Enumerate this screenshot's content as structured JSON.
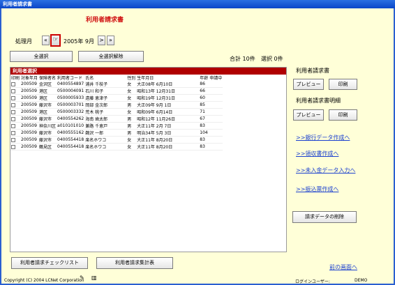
{
  "window": {
    "title": "利用者請求書"
  },
  "header": {
    "title": "利用者請求書"
  },
  "period": {
    "label": "処理月",
    "value": "2005年 9月",
    "first": "«",
    "prev": "‹",
    "next": ">",
    "last": "»"
  },
  "toolbar": {
    "select_all": "全選択",
    "deselect_all": "全選択解除"
  },
  "summary": {
    "total": "合計 10件",
    "selected": "選択 0件"
  },
  "list": {
    "title": "利用者選択",
    "columns": [
      "印刷",
      "対象年月",
      "保険者名",
      "利用者コード",
      "氏名",
      "性別",
      "生年月日",
      "年齢",
      "申請中"
    ],
    "rows": [
      [
        "200509",
        "金沢区",
        "0400554897",
        "浦井 千枝子",
        "女",
        "大正08年 6月10日",
        "86"
      ],
      [
        "200509",
        "港区",
        "0500004091",
        "石川 和子",
        "女",
        "昭和13年 12月31日",
        "66"
      ],
      [
        "200509",
        "港区",
        "0500005933",
        "遠藤 恵津子",
        "女",
        "昭和19年 12月31日",
        "60"
      ],
      [
        "200509",
        "藤沢市",
        "0500003701",
        "岡部 金次郎",
        "男",
        "大正09年 9月 1日",
        "85"
      ],
      [
        "200509",
        "港区",
        "0500003332",
        "荒木 桃子",
        "女",
        "昭和09年 6月14日",
        "71"
      ],
      [
        "200509",
        "藤沢市",
        "0400554262",
        "海南 歯太郎",
        "男",
        "昭和12年 11月26日",
        "67"
      ],
      [
        "200509",
        "神奈川区",
        "a010101010",
        "兼路 千恵戸",
        "男",
        "大正11年 2月 7日",
        "83"
      ],
      [
        "200509",
        "藤沢市",
        "0400555162",
        "鵜沢 一郎",
        "男",
        "明治34年 5月 3日",
        "104"
      ],
      [
        "200509",
        "藤沢市",
        "0400554418",
        "楽名ホワコ",
        "女",
        "大正11年 8月20日",
        "83"
      ],
      [
        "200509",
        "鶴見区",
        "0400554418",
        "楽名ホワコ",
        "女",
        "大正11年 8月20日",
        "83"
      ]
    ]
  },
  "right": {
    "invoice_label": "利用者請求書",
    "detail_label": "利用者請求書明細",
    "preview": "プレビュー",
    "print": "印刷",
    "links": [
      ">>銀行データ作成へ",
      ">>領収書作成へ",
      ">>未入金データ入力へ",
      ">>振込票作成へ"
    ],
    "delete_btn": "請求データの削除",
    "back_link": "前の画面へ"
  },
  "bottom": {
    "checklist_btn": "利用者請求チェックリスト",
    "summary_btn": "利用者請求集計表"
  },
  "status": {
    "copyright": "Copyright (C) 2004 LCNet Corporation",
    "user_label": "ログインユーザー:",
    "user": "DEMO"
  }
}
